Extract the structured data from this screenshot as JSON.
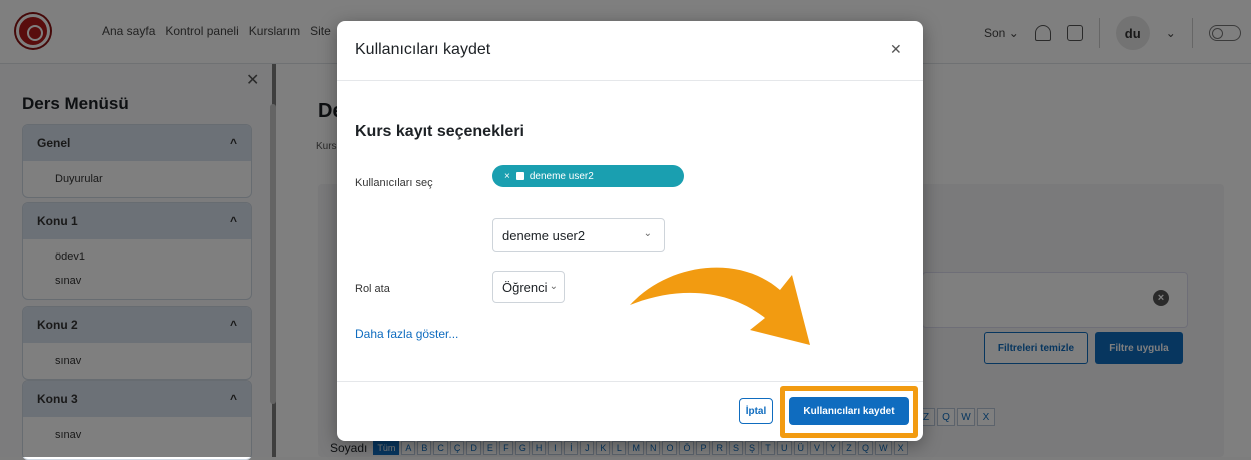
{
  "navbar": {
    "links": [
      "Ana sayfa",
      "Kontrol paneli",
      "Kurslarım",
      "Site"
    ],
    "recent_label": "Son",
    "avatar_initials": "du"
  },
  "drawer": {
    "title": "Ders Menüsü",
    "sections": [
      {
        "title": "Genel",
        "items": [
          "Duyurular"
        ]
      },
      {
        "title": "Konu 1",
        "items": [
          "ödev1",
          "sınav"
        ]
      },
      {
        "title": "Konu 2",
        "items": [
          "sınav"
        ]
      },
      {
        "title": "Konu 3",
        "items": [
          "sınav"
        ]
      }
    ]
  },
  "main": {
    "title_partial": "De",
    "breadcrumb_partial": "Kurs",
    "clear_filters_label": "Filtreleri temizle",
    "apply_filter_label": "Filtre uygula",
    "letters_top": [
      "Z",
      "Q",
      "W",
      "X"
    ],
    "surname_label": "Soyadı",
    "surname_letters": [
      "Tüm",
      "A",
      "B",
      "C",
      "Ç",
      "D",
      "E",
      "F",
      "G",
      "H",
      "I",
      "İ",
      "J",
      "K",
      "L",
      "M",
      "N",
      "O",
      "Ö",
      "P",
      "R",
      "S",
      "Ş",
      "T",
      "U",
      "Ü",
      "V",
      "Y",
      "Z",
      "Q",
      "W",
      "X"
    ]
  },
  "modal": {
    "title": "Kullanıcıları kaydet",
    "section_heading": "Kurs kayıt seçenekleri",
    "select_users_label": "Kullanıcıları seç",
    "selected_user_chip": "deneme user2",
    "user_select_value": "deneme user2",
    "role_label": "Rol ata",
    "role_value": "Öğrenci",
    "show_more": "Daha fazla göster...",
    "cancel_label": "İptal",
    "save_label": "Kullanıcıları kaydet"
  },
  "colors": {
    "primary": "#0f6cbf",
    "chip": "#1a9fb0",
    "highlight": "#f29b11"
  }
}
